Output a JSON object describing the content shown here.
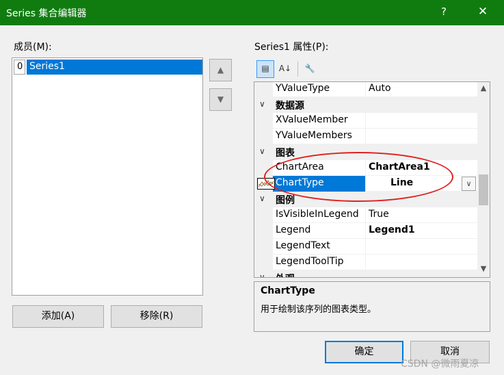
{
  "window": {
    "title": "Series 集合编辑器",
    "help_glyph": "?",
    "close_glyph": "✕"
  },
  "members": {
    "label": "成员(M):",
    "items": [
      {
        "index": "0",
        "name": "Series1"
      }
    ],
    "move_up_icon": "arrow-up-icon",
    "move_down_icon": "arrow-down-icon"
  },
  "properties": {
    "label": "Series1 属性(P):",
    "toolbar": {
      "categorized_glyph": "▤",
      "alphabetical_glyph": "A↓",
      "property_pages_glyph": "🔧"
    },
    "rows": [
      {
        "kind": "prop",
        "name": "YValueType",
        "value": "Auto",
        "bold": false
      },
      {
        "kind": "cat",
        "name": "数据源"
      },
      {
        "kind": "prop",
        "name": "XValueMember",
        "value": "",
        "bold": false
      },
      {
        "kind": "prop",
        "name": "YValueMembers",
        "value": "",
        "bold": false
      },
      {
        "kind": "cat",
        "name": "图表"
      },
      {
        "kind": "prop",
        "name": "ChartArea",
        "value": "ChartArea1",
        "bold": true
      },
      {
        "kind": "sel",
        "name": "ChartType",
        "value": "Line",
        "bold": true
      },
      {
        "kind": "cat",
        "name": "图例"
      },
      {
        "kind": "prop",
        "name": "IsVisibleInLegend",
        "value": "True",
        "bold": false
      },
      {
        "kind": "prop",
        "name": "Legend",
        "value": "Legend1",
        "bold": true
      },
      {
        "kind": "prop",
        "name": "LegendText",
        "value": "",
        "bold": false
      },
      {
        "kind": "prop",
        "name": "LegendToolTip",
        "value": "",
        "bold": false
      },
      {
        "kind": "cat",
        "name": "外观"
      }
    ],
    "description": {
      "title": "ChartType",
      "text": "用于绘制该序列的图表类型。"
    }
  },
  "buttons": {
    "add": "添加(A)",
    "remove": "移除(R)",
    "ok": "确定",
    "cancel": "取消"
  },
  "watermark": "CSDN @微雨夏凉",
  "colors": {
    "titlebar": "#107c10",
    "selection": "#0078d7",
    "annotation": "#e02020"
  }
}
